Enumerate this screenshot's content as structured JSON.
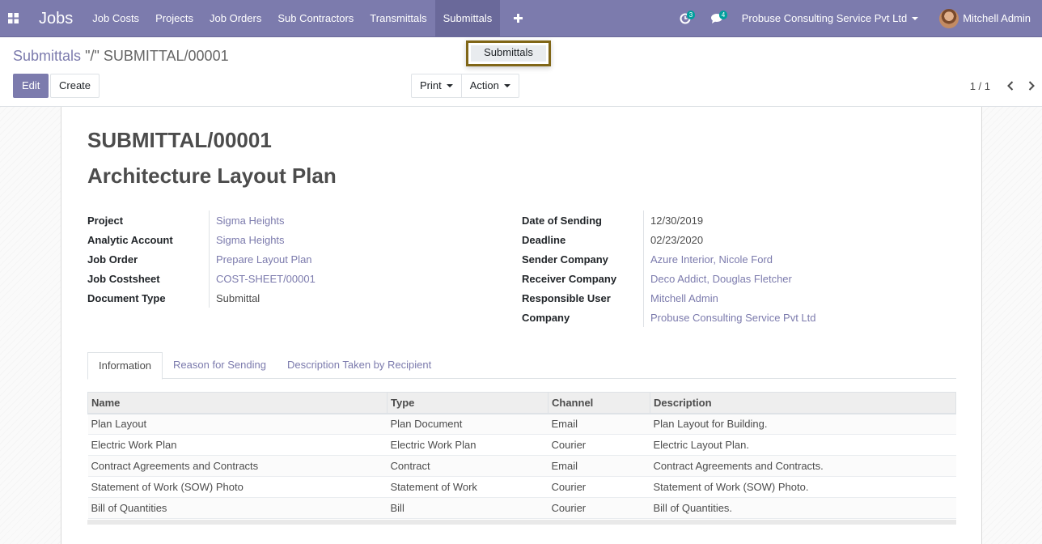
{
  "navbar": {
    "app_name": "Jobs",
    "menu": [
      "Job Costs",
      "Projects",
      "Job Orders",
      "Sub Contractors",
      "Transmittals",
      "Submittals"
    ],
    "active_menu": "Submittals",
    "activity_count": "3",
    "message_count": "4",
    "company": "Probuse Consulting Service Pvt Ltd",
    "user": "Mitchell Admin",
    "bg_color": "#7c7bad"
  },
  "dropdown": {
    "item": "Submittals"
  },
  "control_panel": {
    "breadcrumb_link": "Submittals",
    "breadcrumb_sep": "\"/\"",
    "breadcrumb_current": "SUBMITTAL/00001",
    "edit_label": "Edit",
    "create_label": "Create",
    "print_label": "Print",
    "action_label": "Action",
    "pager_value": "1 / 1"
  },
  "record": {
    "name": "SUBMITTAL/00001",
    "title": "Architecture Layout Plan",
    "left_fields": [
      {
        "label": "Project",
        "value": "Sigma Heights",
        "link": true
      },
      {
        "label": "Analytic Account",
        "value": "Sigma Heights",
        "link": true
      },
      {
        "label": "Job Order",
        "value": "Prepare Layout Plan",
        "link": true
      },
      {
        "label": "Job Costsheet",
        "value": "COST-SHEET/00001",
        "link": true
      },
      {
        "label": "Document Type",
        "value": "Submittal",
        "link": false
      }
    ],
    "right_fields": [
      {
        "label": "Date of Sending",
        "value": "12/30/2019",
        "link": false
      },
      {
        "label": "Deadline",
        "value": "02/23/2020",
        "link": false
      },
      {
        "label": "Sender Company",
        "value": "Azure Interior, Nicole Ford",
        "link": true
      },
      {
        "label": "Receiver Company",
        "value": "Deco Addict, Douglas Fletcher",
        "link": true
      },
      {
        "label": "Responsible User",
        "value": "Mitchell Admin",
        "link": true
      },
      {
        "label": "Company",
        "value": "Probuse Consulting Service Pvt Ltd",
        "link": true
      }
    ]
  },
  "notebook": {
    "tabs": [
      "Information",
      "Reason for Sending",
      "Description Taken by Recipient"
    ],
    "active_tab": "Information",
    "columns": [
      "Name",
      "Type",
      "Channel",
      "Description"
    ],
    "rows": [
      [
        "Plan Layout",
        "Plan Document",
        "Email",
        "Plan Layout for Building."
      ],
      [
        "Electric Work Plan",
        "Electric Work Plan",
        "Courier",
        "Electric Layout Plan."
      ],
      [
        "Contract Agreements and Contracts",
        "Contract",
        "Email",
        "Contract Agreements and Contracts."
      ],
      [
        "Statement of Work (SOW) Photo",
        "Statement of Work",
        "Courier",
        "Statement of Work (SOW) Photo."
      ],
      [
        "Bill of Quantities",
        "Bill",
        "Courier",
        "Bill of Quantities."
      ]
    ]
  }
}
